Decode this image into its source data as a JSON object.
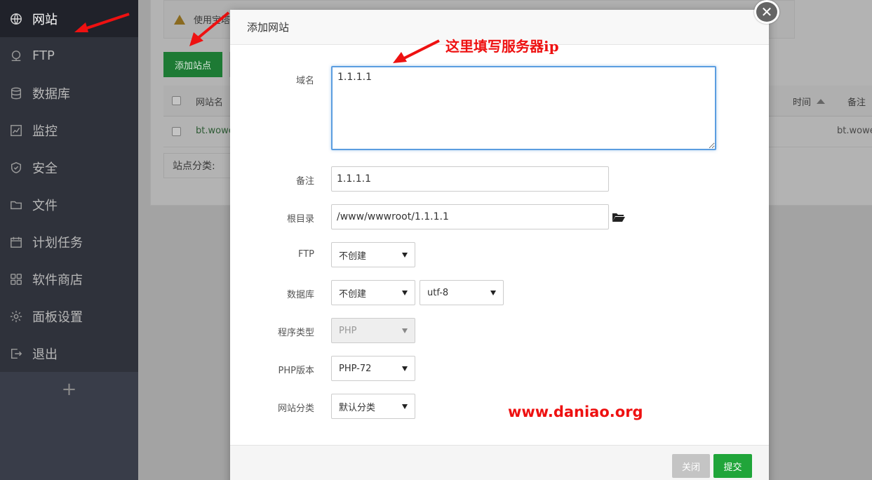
{
  "sidebar": {
    "items": [
      {
        "label": "网站",
        "icon": "globe-icon",
        "active": true
      },
      {
        "label": "FTP",
        "icon": "ftp-icon",
        "active": false
      },
      {
        "label": "数据库",
        "icon": "database-icon",
        "active": false
      },
      {
        "label": "监控",
        "icon": "monitor-icon",
        "active": false
      },
      {
        "label": "安全",
        "icon": "shield-icon",
        "active": false
      },
      {
        "label": "文件",
        "icon": "folder-icon",
        "active": false
      },
      {
        "label": "计划任务",
        "icon": "calendar-icon",
        "active": false
      },
      {
        "label": "软件商店",
        "icon": "grid-icon",
        "active": false
      },
      {
        "label": "面板设置",
        "icon": "gear-icon",
        "active": false
      },
      {
        "label": "退出",
        "icon": "logout-icon",
        "active": false
      }
    ],
    "add_label": "+"
  },
  "background": {
    "notice_text": "使用宝塔",
    "add_site_button": "添加站点",
    "table_header_name": "网站名",
    "table_header_time": "时间",
    "table_header_note": "备注",
    "row_name": "bt.wowe",
    "row_note": "bt.woweiw",
    "category_label": "站点分类:"
  },
  "modal": {
    "title": "添加网站",
    "close_symbol": "✕",
    "fields": {
      "domain_label": "域名",
      "domain_value": "1.1.1.1",
      "note_label": "备注",
      "note_value": "1.1.1.1",
      "root_label": "根目录",
      "root_value": "/www/wwwroot/1.1.1.1",
      "ftp_label": "FTP",
      "ftp_value": "不创建",
      "db_label": "数据库",
      "db_value": "不创建",
      "db_charset": "utf-8",
      "program_label": "程序类型",
      "program_value": "PHP",
      "php_label": "PHP版本",
      "php_value": "PHP-72",
      "category_label": "网站分类",
      "category_value": "默认分类"
    },
    "buttons": {
      "close": "关闭",
      "submit": "提交"
    }
  },
  "annotations": {
    "hint": "这里填写服务器ip",
    "watermark": "www.daniao.org"
  },
  "colors": {
    "accent_green": "#20a53a",
    "sidebar_bg": "#2f323b",
    "annotation_red": "#ee1111"
  }
}
